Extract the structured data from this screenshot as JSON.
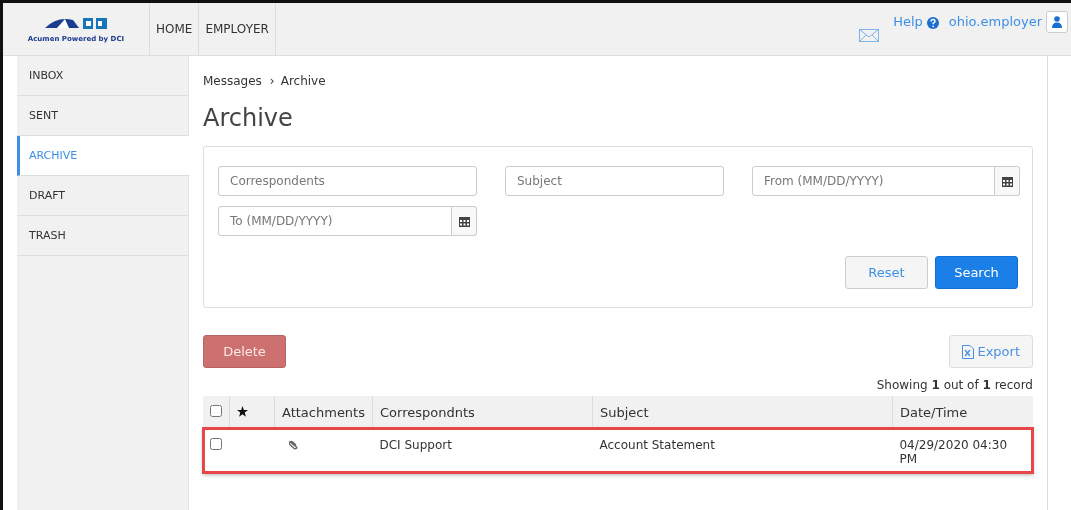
{
  "header": {
    "logo_caption": "Acumen Powered by DCI",
    "nav": [
      {
        "label": "HOME",
        "selected": false
      },
      {
        "label": "EMPLOYER",
        "selected": false
      }
    ],
    "help": "Help",
    "user": "ohio.employer"
  },
  "sidebar": {
    "items": [
      {
        "label": "INBOX",
        "selected": false
      },
      {
        "label": "SENT",
        "selected": false
      },
      {
        "label": "ARCHIVE",
        "selected": true
      },
      {
        "label": "DRAFT",
        "selected": false
      },
      {
        "label": "TRASH",
        "selected": false
      }
    ]
  },
  "breadcrumb": {
    "parent": "Messages",
    "separator": "›",
    "current": "Archive"
  },
  "title": "Archive",
  "filters": {
    "fields": [
      {
        "placeholder": "Correspondents",
        "kind": "text"
      },
      {
        "placeholder": "Subject",
        "kind": "text"
      },
      {
        "placeholder": "From (MM/DD/YYYY)",
        "kind": "date"
      },
      {
        "placeholder": "To (MM/DD/YYYY)",
        "kind": "date"
      }
    ],
    "reset": "Reset",
    "search": "Search"
  },
  "delete": "Delete",
  "export": "Export",
  "showing": "Showing **1** out of **1** record",
  "table": {
    "select_all_checked": false,
    "columns": [
      "Attachments",
      "Correspondnts",
      "Subject",
      "Date/Time"
    ],
    "rows": [
      {
        "checked": false,
        "has_attachment": true,
        "correspondent": "DCI Support",
        "subject": "Account Statement",
        "datetime": "04/29/2020 04:30 PM",
        "highlighted": true
      }
    ]
  }
}
